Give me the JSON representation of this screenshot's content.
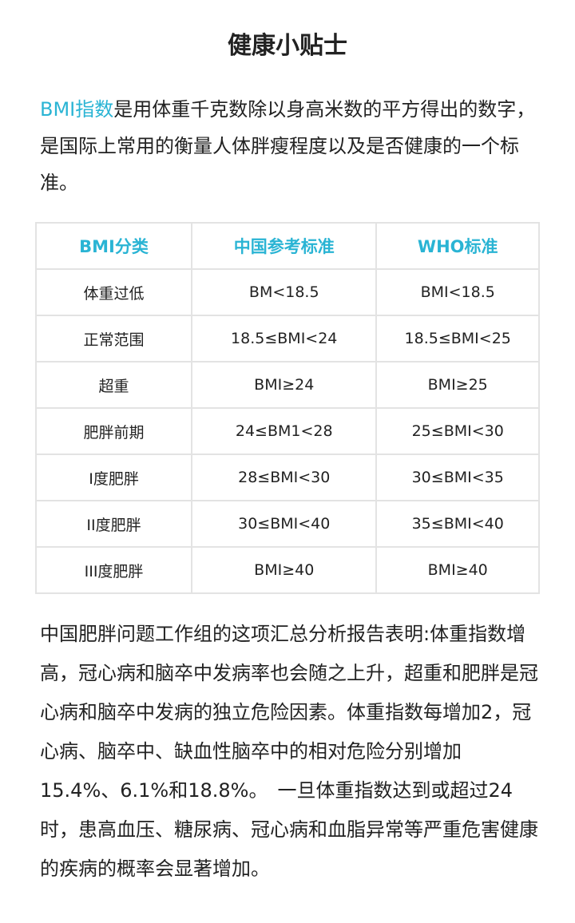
{
  "title": "健康小贴士",
  "intro": {
    "highlight": "BMI指数",
    "text": "是用体重千克数除以身高米数的平方得出的数字，是国际上常用的衡量人体胖瘦程度以及是否健康的一个标准。"
  },
  "table": {
    "headers": [
      "BMI分类",
      "中国参考标准",
      "WHO标准"
    ],
    "rows": [
      [
        "体重过低",
        "BM<18.5",
        "BMI<18.5"
      ],
      [
        "正常范围",
        "18.5≤BMI<24",
        "18.5≤BMI<25"
      ],
      [
        "超重",
        "BMI≥24",
        "BMI≥25"
      ],
      [
        "肥胖前期",
        "24≤BM1<28",
        "25≤BMI<30"
      ],
      [
        "I度肥胖",
        "28≤BMI<30",
        "30≤BMI<35"
      ],
      [
        "II度肥胖",
        "30≤BMI<40",
        "35≤BMI<40"
      ],
      [
        "III度肥胖",
        "BMI≥40",
        "BMI≥40"
      ]
    ]
  },
  "body": "中国肥胖问题工作组的这项汇总分析报告表明:体重指数增高，冠心病和脑卒中发病率也会随之上升，超重和肥胖是冠心病和脑卒中发病的独立危险因素。体重指数每增加2，冠心病、脑卒中、缺血性脑卒中的相对危险分别增加15.4%、6.1%和18.8%。　一旦体重指数达到或超过24时，患高血压、糖尿病、冠心病和血脂异常等严重危害健康的疾病的概率会显著增加。",
  "colors": {
    "accent": "#2ab4d4",
    "text": "#222222",
    "border": "#e3e3e3"
  }
}
